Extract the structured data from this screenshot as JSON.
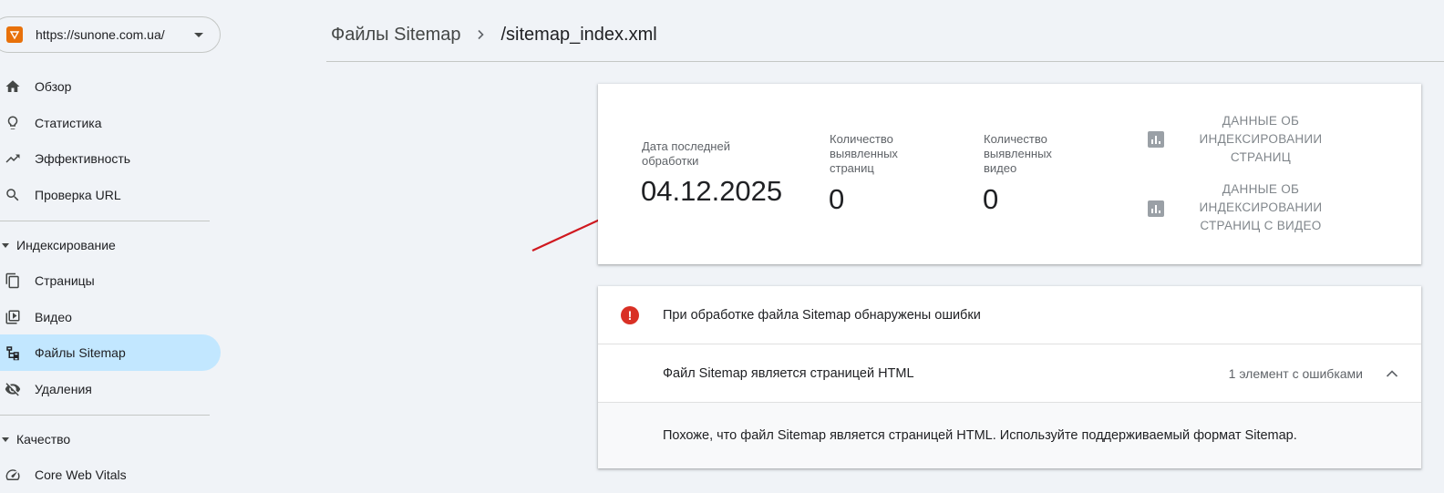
{
  "property": {
    "url": "https://sunone.com.ua/"
  },
  "nav": {
    "overview": "Обзор",
    "stats": "Статистика",
    "performance": "Эффективность",
    "url_inspection": "Проверка URL",
    "indexing_section": "Индексирование",
    "pages": "Страницы",
    "video": "Видео",
    "sitemaps": "Файлы Sitemap",
    "removals": "Удаления",
    "quality_section": "Качество",
    "cwv": "Core Web Vitals"
  },
  "breadcrumb": {
    "parent": "Файлы Sitemap",
    "current": "/sitemap_index.xml"
  },
  "stats": {
    "last_read_label": "Дата последней обработки",
    "last_read_value": "04.12.2025",
    "pages_label": "Количество выявленных страниц",
    "pages_value": "0",
    "videos_label": "Количество выявленных видео",
    "videos_value": "0",
    "page_index_link": "ДАННЫЕ ОБ ИНДЕКСИРОВАНИИ СТРАНИЦ",
    "video_index_link": "ДАННЫЕ ОБ ИНДЕКСИРОВАНИИ СТРАНИЦ С ВИДЕО"
  },
  "errors": {
    "header": "При обработке файла Sitemap обнаружены ошибки",
    "item_title": "Файл Sitemap является страницей HTML",
    "item_count": "1 элемент с ошибками",
    "detail": "Похоже, что файл Sitemap является страницей HTML. Используйте поддерживаемый формат Sitemap."
  },
  "colors": {
    "active_nav": "#c2e7ff",
    "error": "#d93025",
    "arrow": "#d0181f"
  }
}
